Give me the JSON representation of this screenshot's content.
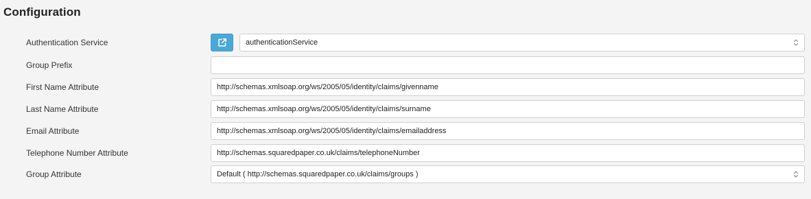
{
  "section": {
    "title": "Configuration"
  },
  "fields": {
    "authentication_service": {
      "label": "Authentication Service",
      "value": "authenticationService"
    },
    "group_prefix": {
      "label": "Group Prefix",
      "value": ""
    },
    "first_name_attribute": {
      "label": "First Name Attribute",
      "value": "http://schemas.xmlsoap.org/ws/2005/05/identity/claims/givenname"
    },
    "last_name_attribute": {
      "label": "Last Name Attribute",
      "value": "http://schemas.xmlsoap.org/ws/2005/05/identity/claims/surname"
    },
    "email_attribute": {
      "label": "Email Attribute",
      "value": "http://schemas.xmlsoap.org/ws/2005/05/identity/claims/emailaddress"
    },
    "telephone_number_attribute": {
      "label": "Telephone Number Attribute",
      "value": "http://schemas.squaredpaper.co.uk/claims/telephoneNumber"
    },
    "group_attribute": {
      "label": "Group Attribute",
      "value": "Default ( http://schemas.squaredpaper.co.uk/claims/groups )"
    }
  },
  "icons": {
    "open_external": "external-link-icon",
    "select_arrows": "chevron-up-down-icon"
  },
  "colors": {
    "accent_button": "#4aa8d6",
    "background": "#f4f4f4",
    "field_border": "#cfcfcf"
  }
}
